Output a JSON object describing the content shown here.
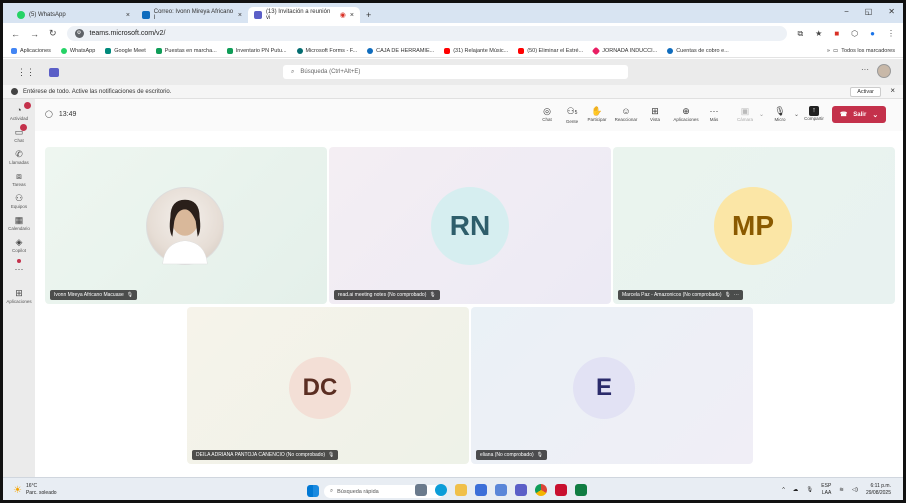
{
  "browser": {
    "tabs": [
      {
        "label": "(5) WhatsApp",
        "color": "#25d366",
        "active": false
      },
      {
        "label": "Correo: Ivonn Mireya Africano I",
        "color": "#0f6cbd",
        "active": false
      },
      {
        "label": "(13) Invitación a reunión vi",
        "color": "#5b5fc7",
        "active": true
      }
    ],
    "url": "teams.microsoft.com/v2/",
    "bookmarks": [
      {
        "label": "Aplicaciones",
        "color": "#4285f4"
      },
      {
        "label": "WhatsApp",
        "color": "#25d366"
      },
      {
        "label": "Google Meet",
        "color": "#00897b"
      },
      {
        "label": "Puestas en marcha...",
        "color": "#0f9d58"
      },
      {
        "label": "Inventario PN Putu...",
        "color": "#0f9d58"
      },
      {
        "label": "Microsoft Forms - F...",
        "color": "#036c70"
      },
      {
        "label": "CAJA DE HERRAMIE...",
        "color": "#0f6cbd"
      },
      {
        "label": "(31) Relajante Músic...",
        "color": "#ff0000"
      },
      {
        "label": "(50) Eliminar el Estré...",
        "color": "#ff0000"
      },
      {
        "label": "JORNADA INDUCCI...",
        "color": "#e91e63"
      },
      {
        "label": "Cuentas de cobro e...",
        "color": "#0f6cbd"
      }
    ],
    "all_bookmarks": "Todos los marcadores"
  },
  "teams": {
    "search_placeholder": "Búsqueda (Ctrl+Alt+E)",
    "notice_text": "Entérese de todo. Active las notificaciones de escritorio.",
    "notice_button": "Activar",
    "rail": [
      {
        "label": "Actividad",
        "glyph": "🔔",
        "badge": "●"
      },
      {
        "label": "Chat",
        "glyph": "💬",
        "badge": "●"
      },
      {
        "label": "Llamadas",
        "glyph": "📞",
        "badge": ""
      },
      {
        "label": "Tareas",
        "glyph": "🗂",
        "badge": ""
      },
      {
        "label": "Equipos",
        "glyph": "👥",
        "badge": ""
      },
      {
        "label": "Calendario",
        "glyph": "📅",
        "badge": ""
      },
      {
        "label": "Copilot",
        "glyph": "✦",
        "badge": ""
      },
      {
        "label": "Aplicaciones",
        "glyph": "⊞",
        "badge": ""
      }
    ],
    "more_glyph": "···",
    "meeting": {
      "timer": "13:49",
      "controls": [
        {
          "label": "Chat",
          "glyph": "💬"
        },
        {
          "label": "Gente",
          "glyph": "👥",
          "count": "5"
        },
        {
          "label": "Participar",
          "glyph": "✋"
        },
        {
          "label": "Reaccionar",
          "glyph": "☺"
        },
        {
          "label": "Vista",
          "glyph": "⊞"
        },
        {
          "label": "Aplicaciones",
          "glyph": "⊕"
        },
        {
          "label": "Más",
          "glyph": "···"
        },
        {
          "label": "Cámara",
          "glyph": "📷"
        },
        {
          "label": "Micro",
          "glyph": "🎤"
        },
        {
          "label": "Compartir",
          "glyph": "⬆"
        }
      ],
      "leave_label": "Salir",
      "participants": [
        {
          "name": "Ivonn Mireya Africano Macuase",
          "initials": "",
          "avatar_bg": "#ffffff",
          "avatar_fg": "#333333",
          "tile_bg": "#e9f3ee"
        },
        {
          "name": "read.ai meeting notes (No comprobado)",
          "initials": "RN",
          "avatar_bg": "#d6eef0",
          "avatar_fg": "#2e5e6b",
          "tile_bg": "#f1ecf4"
        },
        {
          "name": "Marcela Paz - Amazonicos (No comprobado)",
          "initials": "MP",
          "avatar_bg": "#fbe6a6",
          "avatar_fg": "#8a5a00",
          "tile_bg": "#eaf3ee"
        },
        {
          "name": "DEILA ADRIANA PANTOJA CANENCIO (No comprobado)",
          "initials": "DC",
          "avatar_bg": "#f3dfd6",
          "avatar_fg": "#5b2e22",
          "tile_bg": "#f4f1e8"
        },
        {
          "name": "eliana (No comprobado)",
          "initials": "E",
          "avatar_bg": "#e2e2f4",
          "avatar_fg": "#2b2b6b",
          "tile_bg": "#edf1f6"
        }
      ]
    }
  },
  "taskbar": {
    "weather_temp": "16°C",
    "weather_desc": "Parc. soleado",
    "search_placeholder": "Búsqueda rápida",
    "lang": "ESP",
    "lang_sub": "LAA",
    "time": "6:11 p.m.",
    "date": "29/08/2025"
  }
}
